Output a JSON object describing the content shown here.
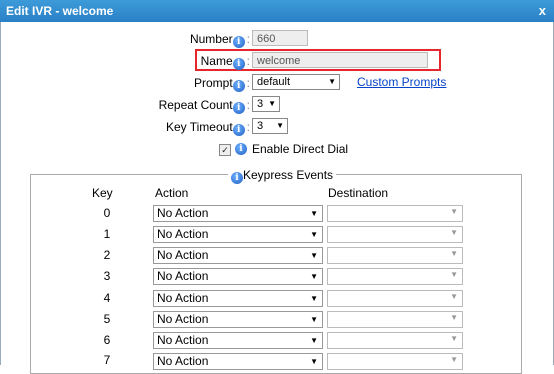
{
  "window": {
    "title": "Edit IVR - welcome",
    "close_label": "x"
  },
  "form": {
    "number_label": "Number",
    "number_value": "660",
    "name_label": "Name",
    "name_value": "welcome",
    "prompt_label": "Prompt",
    "prompt_value": "default",
    "custom_prompts_link": "Custom Prompts",
    "repeat_label": "Repeat Count",
    "repeat_value": "3",
    "timeout_label": "Key Timeout",
    "timeout_value": "3",
    "direct_dial_label": "Enable Direct Dial",
    "direct_dial_checked": true
  },
  "keypress": {
    "legend": "Keypress Events",
    "headers": {
      "key": "Key",
      "action": "Action",
      "destination": "Destination"
    },
    "rows": [
      {
        "key": "0",
        "action": "No Action",
        "destination": ""
      },
      {
        "key": "1",
        "action": "No Action",
        "destination": ""
      },
      {
        "key": "2",
        "action": "No Action",
        "destination": ""
      },
      {
        "key": "3",
        "action": "No Action",
        "destination": ""
      },
      {
        "key": "4",
        "action": "No Action",
        "destination": ""
      },
      {
        "key": "5",
        "action": "No Action",
        "destination": ""
      },
      {
        "key": "6",
        "action": "No Action",
        "destination": ""
      },
      {
        "key": "7",
        "action": "No Action",
        "destination": ""
      }
    ]
  },
  "icons": {
    "info": "info-icon",
    "dropdown": "dropdown-arrow-icon",
    "check": "checkbox-check-icon"
  },
  "colors": {
    "titlebar": "#2a80c6",
    "highlight": "#e5262a",
    "link": "#0645c8"
  }
}
